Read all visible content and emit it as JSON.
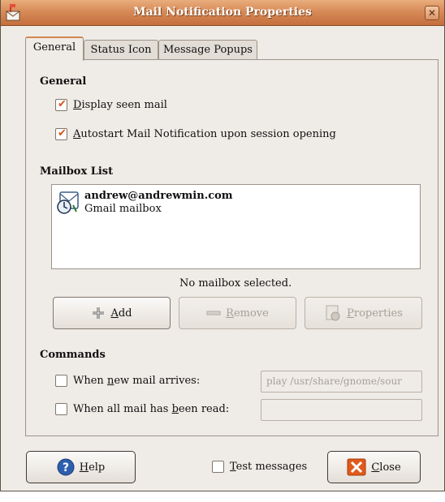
{
  "window": {
    "title": "Mail Notification Properties"
  },
  "tabs": [
    {
      "label": "General",
      "active": true
    },
    {
      "label": "Status Icon",
      "active": false
    },
    {
      "label": "Message Popups",
      "active": false
    }
  ],
  "general": {
    "title": "General",
    "options": [
      {
        "pre": "",
        "u": "D",
        "post": "isplay seen mail",
        "checked": true
      },
      {
        "pre": "",
        "u": "A",
        "post": "utostart Mail Notification upon session opening",
        "checked": true
      }
    ]
  },
  "mailbox_list": {
    "title": "Mailbox List",
    "items": [
      {
        "name": "andrew@andrewmin.com",
        "type": "Gmail mailbox"
      }
    ],
    "status": "No mailbox selected."
  },
  "buttons": {
    "add": {
      "u": "A",
      "post": "dd"
    },
    "remove": {
      "u": "R",
      "post": "emove"
    },
    "properties": {
      "u": "P",
      "post": "roperties"
    }
  },
  "commands": {
    "title": "Commands",
    "new_mail": {
      "pre": "When ",
      "u": "n",
      "post": "ew mail arrives:",
      "value": "play /usr/share/gnome/sour",
      "checked": false
    },
    "all_read": {
      "pre": "When all mail has ",
      "u": "b",
      "post": "een read:",
      "value": "",
      "checked": false
    }
  },
  "footer": {
    "help": {
      "u": "H",
      "post": "elp"
    },
    "test": {
      "u": "T",
      "post": "est messages",
      "checked": false
    },
    "close": {
      "u": "C",
      "post": "lose"
    }
  },
  "colors": {
    "titlebar": "#d78b58",
    "accent": "#d2561b",
    "help_icon": "#2d5fae",
    "close_icon": "#e05a1c"
  }
}
